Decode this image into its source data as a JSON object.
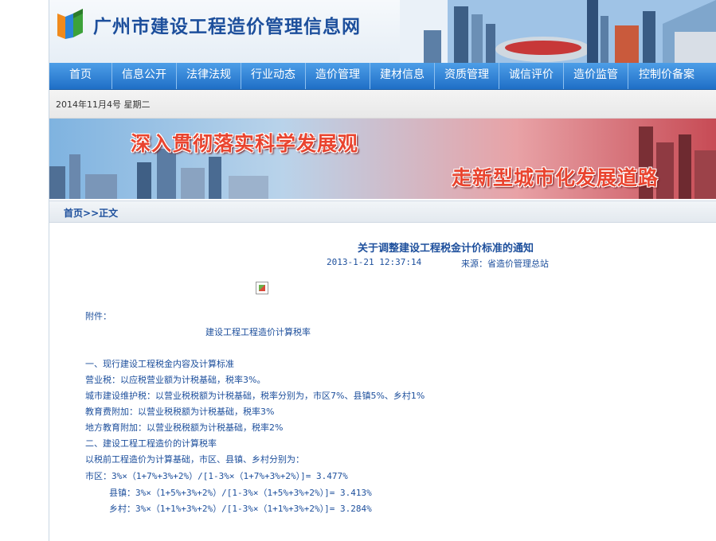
{
  "header": {
    "site_title": "广州市建设工程造价管理信息网"
  },
  "nav": {
    "items": [
      "首页",
      "信息公开",
      "法律法规",
      "行业动态",
      "造价管理",
      "建材信息",
      "资质管理",
      "诚信评价",
      "造价监管",
      "控制价备案"
    ]
  },
  "date_text": "2014年11月4号  星期二",
  "banner": {
    "slogan1": "深入贯彻落实科学发展观",
    "slogan2": "走新型城市化发展道路"
  },
  "breadcrumb": {
    "home": "首页",
    "separator": ">>",
    "current": "正文"
  },
  "article": {
    "title": "关于调整建设工程税金计价标准的通知",
    "time": "2013-1-21 12:37:14",
    "source": "来源：省造价管理总站",
    "attachment_label": "附件：",
    "subtitle": "建设工程工程造价计算税率",
    "lines": [
      "一、现行建设工程税金内容及计算标准",
      "营业税：以应税营业额为计税基础，税率3%。",
      "城市建设维护税：以营业税税额为计税基础，税率分别为，市区7%、县镇5%、乡村1%",
      "教育费附加：以营业税税额为计税基础，税率3%",
      "地方教育附加：以营业税税额为计税基础，税率2%",
      "二、建设工程工程造价的计算税率",
      "以税前工程造价为计算基础，市区、县镇、乡村分别为：",
      "市区：3%×（1+7%+3%+2%）/[1-3%×（1+7%+3%+2%）]= 3.477%",
      "县镇：3%×（1+5%+3%+2%）/[1-3%×（1+5%+3%+2%）]= 3.413%",
      "乡村：3%×（1+1%+3%+2%）/[1-3%×（1+1%+3%+2%）]= 3.284%"
    ]
  },
  "colors": {
    "nav_blue": "#2a7fd6",
    "link_blue": "#1d4f9c",
    "slogan_red": "#e9442f"
  }
}
